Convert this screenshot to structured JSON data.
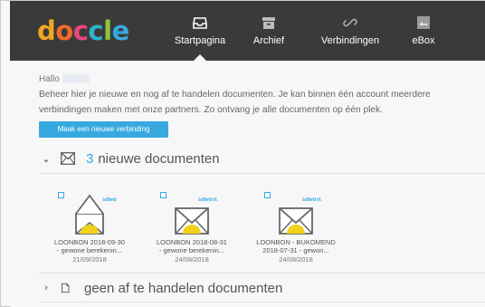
{
  "app": {
    "logo_letters": [
      "d",
      "o",
      "c",
      "c",
      "l",
      "e"
    ],
    "logo_colors": [
      "#f4a622",
      "#f06b2a",
      "#e8467c",
      "#2fb3c8",
      "#8cc63f",
      "#37a9e0"
    ]
  },
  "nav": {
    "items": [
      {
        "label": "Startpagina",
        "icon": "inbox-icon",
        "active": true
      },
      {
        "label": "Archief",
        "icon": "archive-icon",
        "active": false
      },
      {
        "label": "Verbindingen",
        "icon": "link-icon",
        "active": false
      },
      {
        "label": "eBox",
        "icon": "ebox-icon",
        "active": false
      }
    ]
  },
  "main": {
    "greeting": "Hallo",
    "intro": "Beheer hier je nieuwe en nog af te handelen documenten. Je kan binnen één account meerdere verbindingen maken met onze partners. Zo ontvang je alle documenten op één plek.",
    "new_connection_button": "Maak een nieuwe verbinding",
    "new_docs_section": {
      "count": "3",
      "title": "nieuwe documenten"
    },
    "documents": [
      {
        "name_line1": "LOONBON 2018-09-30",
        "name_line2": "- gewone berekenin...",
        "date": "21/09/2018",
        "badge": "sdworx"
      },
      {
        "name_line1": "LOONBON 2018-08-31",
        "name_line2": "- gewone berekenin...",
        "date": "24/08/2018",
        "badge": "sdworx"
      },
      {
        "name_line1": "LOONBON - BUKOMEND",
        "name_line2": "2018-07-31 - gewon...",
        "date": "24/08/2018",
        "badge": "sdworx"
      }
    ],
    "pending_section": {
      "title": "geen af te handelen documenten"
    }
  },
  "colors": {
    "header_bg": "#3a3a3a",
    "accent": "#37a9e0",
    "stamp_yellow": "#f2d21a"
  }
}
